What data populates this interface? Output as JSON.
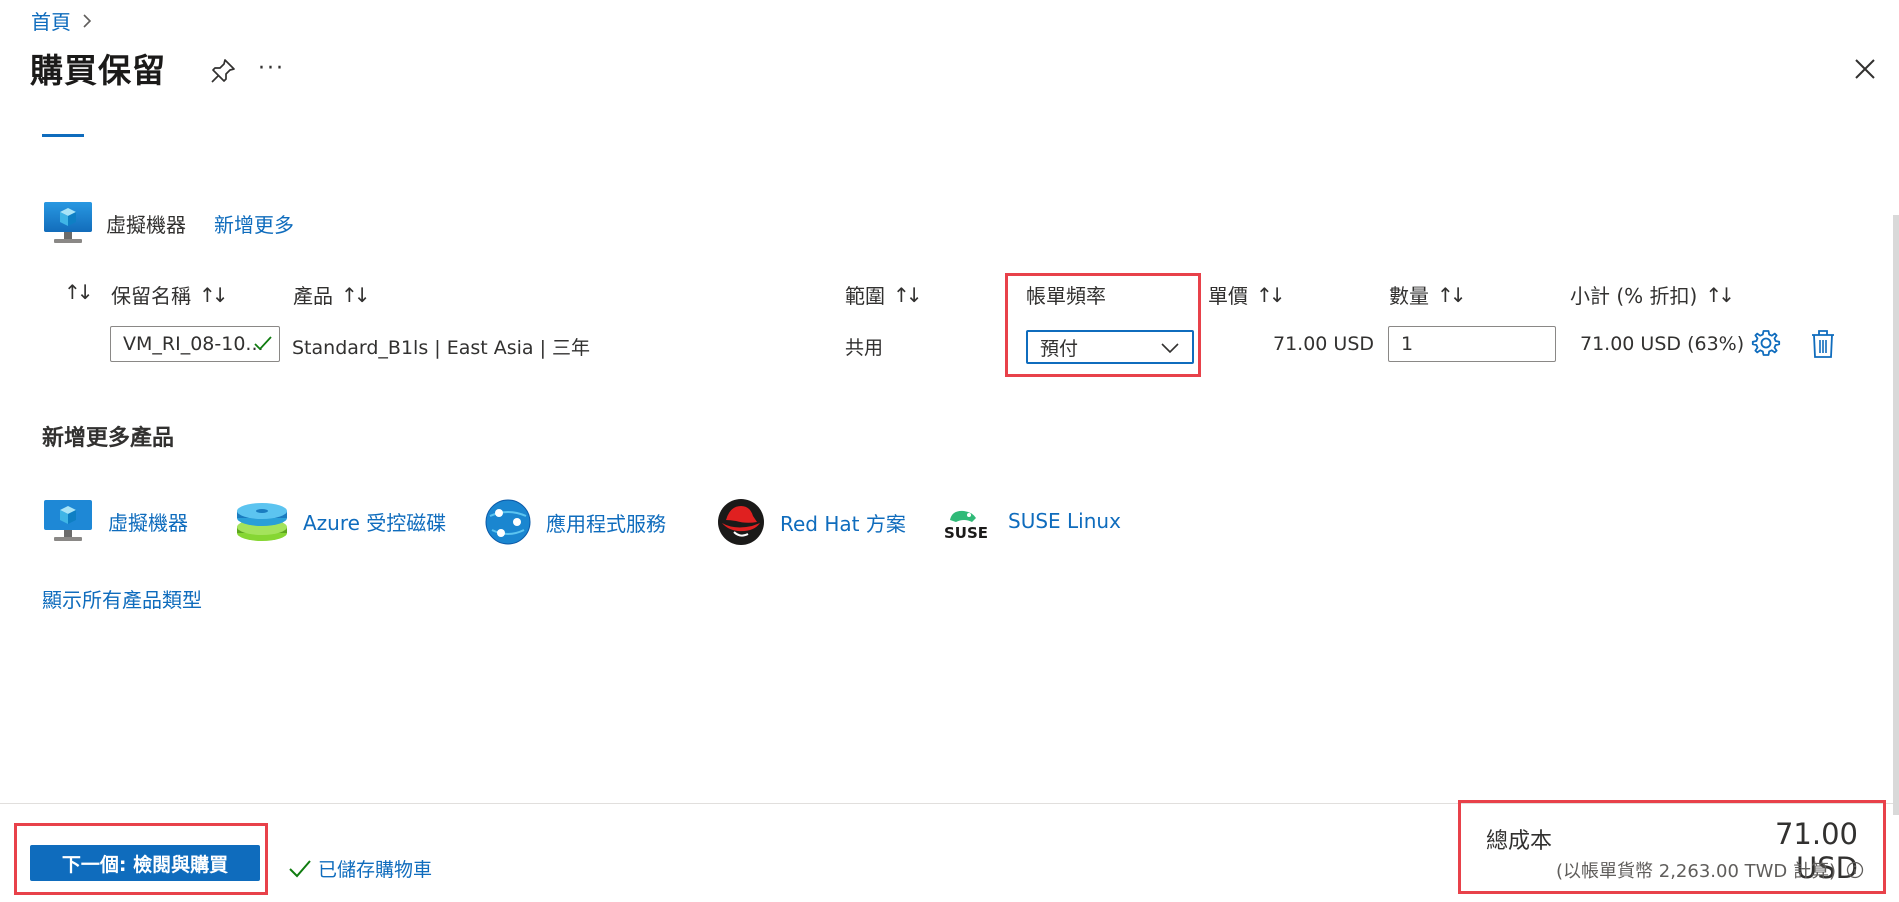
{
  "breadcrumb": {
    "home": "首頁"
  },
  "page": {
    "title": "購買保留"
  },
  "reservation": {
    "resource_label": "虛擬機器",
    "add_more": "新增更多"
  },
  "table": {
    "headers": {
      "name": "保留名稱",
      "product": "產品",
      "scope": "範圍",
      "billing": "帳單頻率",
      "price": "單價",
      "quantity": "數量",
      "subtotal": "小計 (% 折扣)"
    },
    "row": {
      "name": "VM_RI_08-10...",
      "product": "Standard_B1ls | East Asia | 三年",
      "scope": "共用",
      "billing": "預付",
      "price": "71.00 USD",
      "quantity": "1",
      "subtotal": "71.00 USD (63%)"
    }
  },
  "add_products": {
    "heading": "新增更多產品",
    "items": [
      {
        "label": "虛擬機器",
        "icon": "vm-icon"
      },
      {
        "label": "Azure 受控磁碟",
        "icon": "managed-disk-icon"
      },
      {
        "label": "應用程式服務",
        "icon": "app-service-icon"
      },
      {
        "label": "Red Hat 方案",
        "icon": "redhat-icon"
      },
      {
        "label": "SUSE Linux",
        "icon": "suse-icon",
        "logo_text": "SUSE"
      }
    ],
    "show_all": "顯示所有產品類型"
  },
  "footer": {
    "next_button": "下一個: 檢閱與購買",
    "saved": "已儲存購物車",
    "total_label": "總成本",
    "total_value": "71.00 USD",
    "total_sub": "(以帳單貨幣 2,263.00 TWD 計算)"
  },
  "colors": {
    "accent": "#0f6cbd",
    "highlight": "#e8414a",
    "success": "#107c10"
  }
}
